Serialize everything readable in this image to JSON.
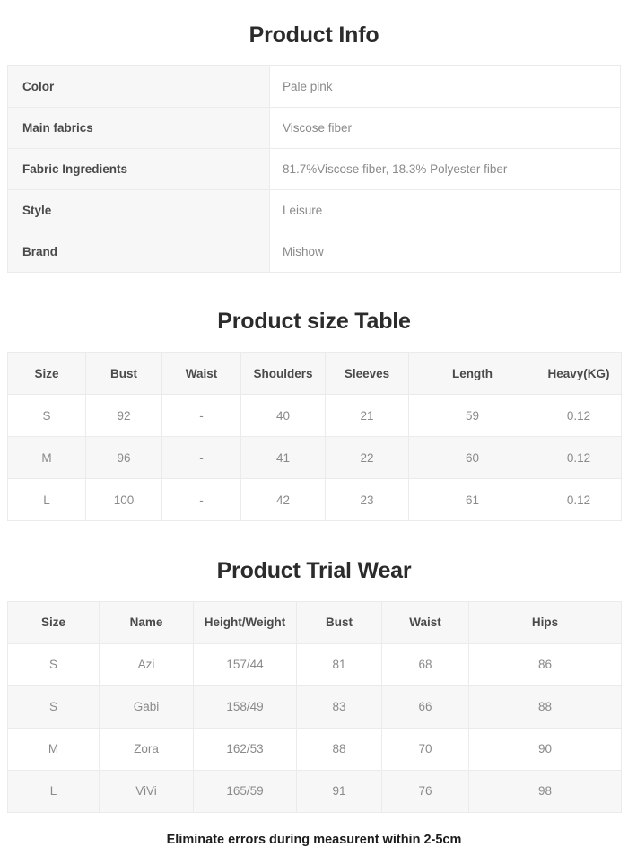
{
  "sections": {
    "product_info": {
      "title": "Product Info",
      "rows": [
        {
          "label": "Color",
          "value": "Pale pink"
        },
        {
          "label": "Main fabrics",
          "value": "Viscose fiber"
        },
        {
          "label": "Fabric Ingredients",
          "value": "81.7%Viscose fiber, 18.3% Polyester fiber"
        },
        {
          "label": "Style",
          "value": "Leisure"
        },
        {
          "label": "Brand",
          "value": "Mishow"
        }
      ]
    },
    "size_table": {
      "title": "Product size Table",
      "headers": [
        "Size",
        "Bust",
        "Waist",
        "Shoulders",
        "Sleeves",
        "Length",
        "Heavy(KG)"
      ],
      "rows": [
        [
          "S",
          "92",
          "-",
          "40",
          "21",
          "59",
          "0.12"
        ],
        [
          "M",
          "96",
          "-",
          "41",
          "22",
          "60",
          "0.12"
        ],
        [
          "L",
          "100",
          "-",
          "42",
          "23",
          "61",
          "0.12"
        ]
      ]
    },
    "trial_wear": {
      "title": "Product Trial Wear",
      "headers": [
        "Size",
        "Name",
        "Height/Weight",
        "Bust",
        "Waist",
        "Hips"
      ],
      "rows": [
        [
          "S",
          "Azi",
          "157/44",
          "81",
          "68",
          "86"
        ],
        [
          "S",
          "Gabi",
          "158/49",
          "83",
          "66",
          "88"
        ],
        [
          "M",
          "Zora",
          "162/53",
          "88",
          "70",
          "90"
        ],
        [
          "L",
          "ViVi",
          "165/59",
          "91",
          "76",
          "98"
        ]
      ]
    }
  },
  "footer": {
    "note": "Eliminate errors during measurent within 2-5cm"
  },
  "colors": {
    "header_background": "#f7f7f7",
    "cell_background": "#ffffff",
    "border": "#ebebeb",
    "label_text": "#4a4a4a",
    "value_text": "#8a8a8a",
    "title_text": "#2b2b2b"
  }
}
